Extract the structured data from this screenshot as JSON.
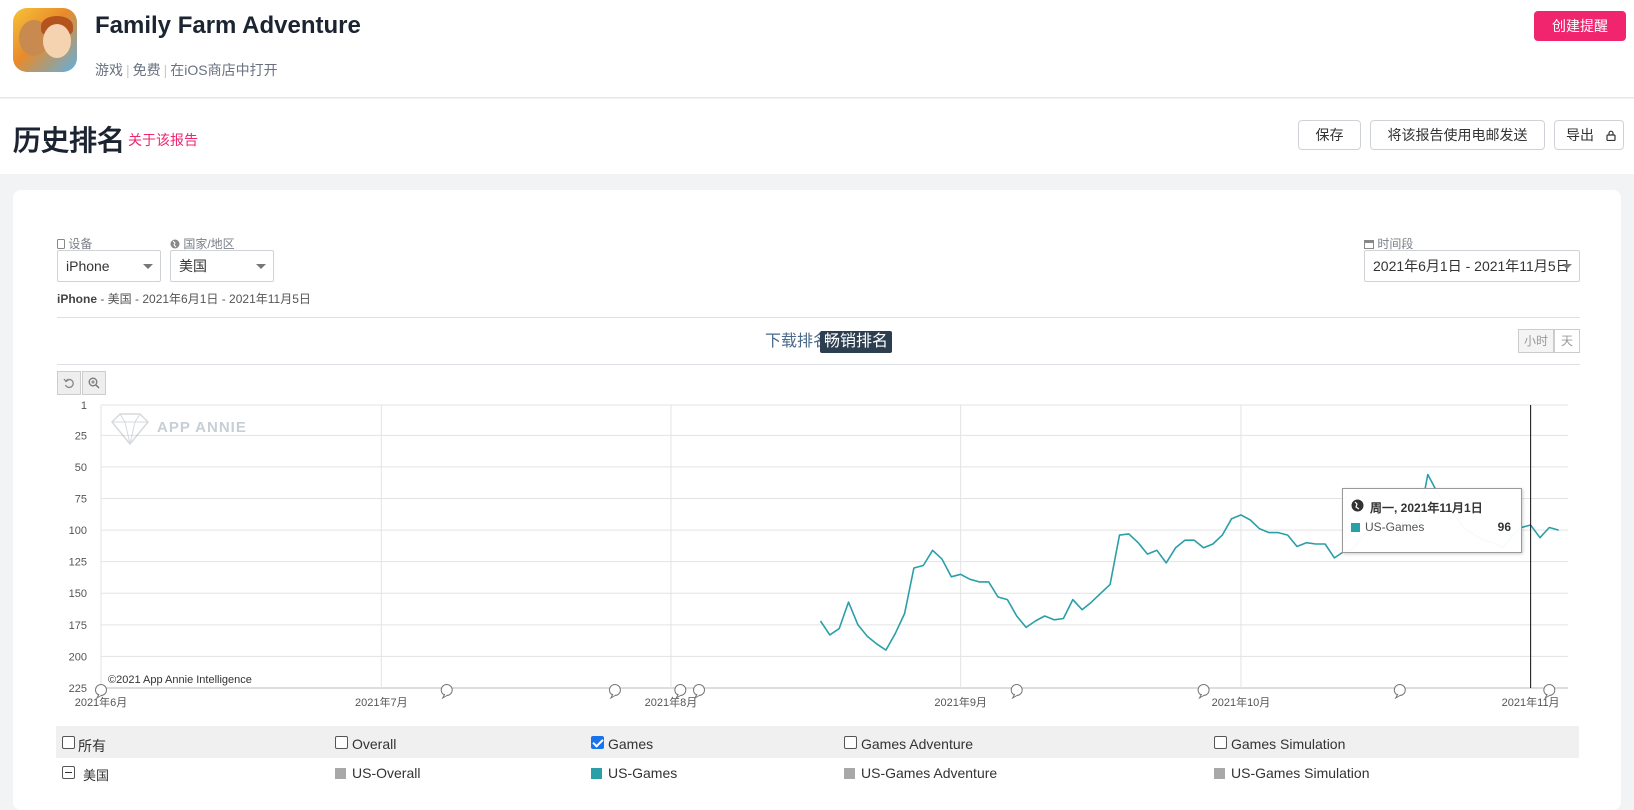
{
  "app": {
    "title": "Family Farm Adventure",
    "category": "游戏",
    "price": "免费",
    "store_link": "在iOS商店中打开",
    "create_alert": "创建提醒"
  },
  "report": {
    "title": "历史排名",
    "about": "关于该报告",
    "save": "保存",
    "email": "将该报告使用电邮发送",
    "export": "导出"
  },
  "filters": {
    "device_label": "设备",
    "device_value": "iPhone",
    "country_label": "国家/地区",
    "country_value": "美国",
    "period_label": "时间段",
    "period_value": "2021年6月1日 - 2021年11月5日",
    "summary_device": "iPhone",
    "summary_rest": " - 美国 - 2021年6月1日 - 2021年11月5日"
  },
  "tabs": {
    "downloads": "下载排名",
    "grossing": "畅销排名",
    "hour": "小时",
    "day": "天"
  },
  "chart_data": {
    "type": "line",
    "watermark": "APP ANNIE",
    "copyright": "©2021 App Annie Intelligence",
    "y_inverted": true,
    "ylim": [
      1,
      225
    ],
    "y_ticks": [
      1,
      25,
      50,
      75,
      100,
      125,
      150,
      175,
      200,
      225
    ],
    "x_ticks": [
      "2021年6月",
      "2021年7月",
      "2021年8月",
      "2021年9月",
      "2021年10月",
      "2021年11月"
    ],
    "grid": true,
    "series": [
      {
        "name": "US-Games",
        "color": "#2a9fa8",
        "points": [
          [
            "2021-08-17",
            172
          ],
          [
            "2021-08-18",
            183
          ],
          [
            "2021-08-19",
            178
          ],
          [
            "2021-08-20",
            157
          ],
          [
            "2021-08-21",
            175
          ],
          [
            "2021-08-22",
            184
          ],
          [
            "2021-08-23",
            190
          ],
          [
            "2021-08-24",
            195
          ],
          [
            "2021-08-25",
            182
          ],
          [
            "2021-08-26",
            166
          ],
          [
            "2021-08-27",
            130
          ],
          [
            "2021-08-28",
            128
          ],
          [
            "2021-08-29",
            116
          ],
          [
            "2021-08-30",
            123
          ],
          [
            "2021-08-31",
            137
          ],
          [
            "2021-09-01",
            135
          ],
          [
            "2021-09-02",
            139
          ],
          [
            "2021-09-03",
            141
          ],
          [
            "2021-09-04",
            141
          ],
          [
            "2021-09-05",
            153
          ],
          [
            "2021-09-06",
            155
          ],
          [
            "2021-09-07",
            168
          ],
          [
            "2021-09-08",
            177
          ],
          [
            "2021-09-09",
            172
          ],
          [
            "2021-09-10",
            168
          ],
          [
            "2021-09-11",
            171
          ],
          [
            "2021-09-12",
            170
          ],
          [
            "2021-09-13",
            155
          ],
          [
            "2021-09-14",
            163
          ],
          [
            "2021-09-15",
            157
          ],
          [
            "2021-09-16",
            150
          ],
          [
            "2021-09-17",
            143
          ],
          [
            "2021-09-18",
            104
          ],
          [
            "2021-09-19",
            103
          ],
          [
            "2021-09-20",
            110
          ],
          [
            "2021-09-21",
            119
          ],
          [
            "2021-09-22",
            116
          ],
          [
            "2021-09-23",
            126
          ],
          [
            "2021-09-24",
            114
          ],
          [
            "2021-09-25",
            108
          ],
          [
            "2021-09-26",
            108
          ],
          [
            "2021-09-27",
            114
          ],
          [
            "2021-09-28",
            111
          ],
          [
            "2021-09-29",
            104
          ],
          [
            "2021-09-30",
            91
          ],
          [
            "2021-10-01",
            88
          ],
          [
            "2021-10-02",
            92
          ],
          [
            "2021-10-03",
            99
          ],
          [
            "2021-10-04",
            102
          ],
          [
            "2021-10-05",
            102
          ],
          [
            "2021-10-06",
            104
          ],
          [
            "2021-10-07",
            113
          ],
          [
            "2021-10-08",
            110
          ],
          [
            "2021-10-09",
            111
          ],
          [
            "2021-10-10",
            111
          ],
          [
            "2021-10-11",
            122
          ],
          [
            "2021-10-12",
            117
          ],
          [
            "2021-10-13",
            115
          ],
          [
            "2021-10-14",
            105
          ],
          [
            "2021-10-15",
            98
          ],
          [
            "2021-10-16",
            102
          ],
          [
            "2021-10-17",
            98
          ],
          [
            "2021-10-18",
            95
          ],
          [
            "2021-10-19",
            93
          ],
          [
            "2021-10-20",
            95
          ],
          [
            "2021-10-21",
            56
          ],
          [
            "2021-10-22",
            70
          ],
          [
            "2021-10-23",
            80
          ],
          [
            "2021-10-24",
            90
          ],
          [
            "2021-10-25",
            99
          ],
          [
            "2021-10-26",
            104
          ],
          [
            "2021-10-27",
            108
          ],
          [
            "2021-10-28",
            110
          ],
          [
            "2021-10-29",
            114
          ],
          [
            "2021-10-30",
            105
          ],
          [
            "2021-10-31",
            98
          ],
          [
            "2021-11-01",
            96
          ],
          [
            "2021-11-02",
            106
          ],
          [
            "2021-11-03",
            98
          ],
          [
            "2021-11-04",
            100
          ]
        ]
      }
    ],
    "tooltip": {
      "date": "周一, 2021年11月1日",
      "series": "US-Games",
      "value": "96"
    }
  },
  "legend": {
    "all": "所有",
    "overall": "Overall",
    "games": "Games",
    "games_adventure": "Games Adventure",
    "games_simulation": "Games Simulation",
    "country": "美国",
    "us_overall": "US-Overall",
    "us_games": "US-Games",
    "us_games_adventure": "US-Games Adventure",
    "us_games_simulation": "US-Games Simulation",
    "colors": {
      "gray": "#a8a8a8",
      "teal": "#2a9fa8",
      "accent": "#f0256e"
    }
  }
}
